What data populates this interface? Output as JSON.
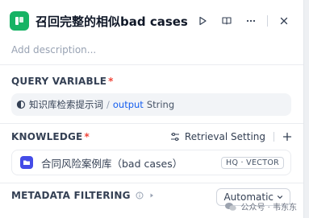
{
  "node": {
    "title": "召回完整的相似bad cases",
    "description_placeholder": "Add description...",
    "icon": "knowledge-retrieval-icon",
    "accent_color": "#16b364"
  },
  "header_actions": [
    "run-icon",
    "book-icon",
    "more-icon",
    "close-icon"
  ],
  "query_variable": {
    "label": "QUERY VARIABLE",
    "required_mark": "*",
    "node_name": "知识库检索提示词",
    "separator": "/",
    "var_name": "output",
    "var_type": "String"
  },
  "knowledge": {
    "label": "KNOWLEDGE",
    "required_mark": "*",
    "retrieval_setting_label": "Retrieval Setting",
    "dataset": {
      "name": "合同风险案例库（bad cases）",
      "badge": "HQ · VECTOR",
      "icon_color": "#444ce7"
    }
  },
  "metadata": {
    "label": "METADATA FILTERING",
    "mode": "Automatic"
  },
  "watermark": {
    "text": "公众号 · 韦东东"
  }
}
